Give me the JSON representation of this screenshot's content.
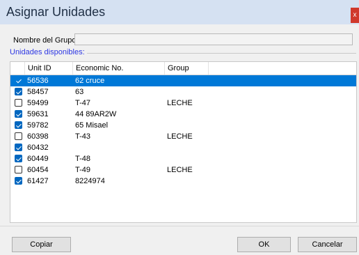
{
  "window": {
    "title": "Asignar Unidades",
    "close_glyph": "x"
  },
  "group": {
    "label": "Nombre del Grupo:",
    "value": ""
  },
  "units_section_label": "Unidades disponibles:",
  "list": {
    "columns": [
      "Unit ID",
      "Economic No.",
      "Group"
    ],
    "rows": [
      {
        "checked": true,
        "selected": true,
        "unit_id": "56536",
        "economic_no": "62 cruce",
        "group": ""
      },
      {
        "checked": true,
        "selected": false,
        "unit_id": "58457",
        "economic_no": "63",
        "group": ""
      },
      {
        "checked": false,
        "selected": false,
        "unit_id": "59499",
        "economic_no": "T-47",
        "group": "LECHE"
      },
      {
        "checked": true,
        "selected": false,
        "unit_id": "59631",
        "economic_no": "44 89AR2W",
        "group": ""
      },
      {
        "checked": true,
        "selected": false,
        "unit_id": "59782",
        "economic_no": "65 Misael",
        "group": ""
      },
      {
        "checked": false,
        "selected": false,
        "unit_id": "60398",
        "economic_no": "T-43",
        "group": "LECHE"
      },
      {
        "checked": true,
        "selected": false,
        "unit_id": "60432",
        "economic_no": "",
        "group": ""
      },
      {
        "checked": true,
        "selected": false,
        "unit_id": "60449",
        "economic_no": "T-48",
        "group": ""
      },
      {
        "checked": false,
        "selected": false,
        "unit_id": "60454",
        "economic_no": "T-49",
        "group": "LECHE"
      },
      {
        "checked": true,
        "selected": false,
        "unit_id": "61427",
        "economic_no": "8224974",
        "group": ""
      }
    ]
  },
  "buttons": {
    "copy": "Copiar",
    "ok": "OK",
    "cancel": "Cancelar"
  },
  "colors": {
    "accent": "#0078d7",
    "section_label": "#2c36e3",
    "title_bar": "#d5e1f2",
    "close": "#d0382b"
  }
}
